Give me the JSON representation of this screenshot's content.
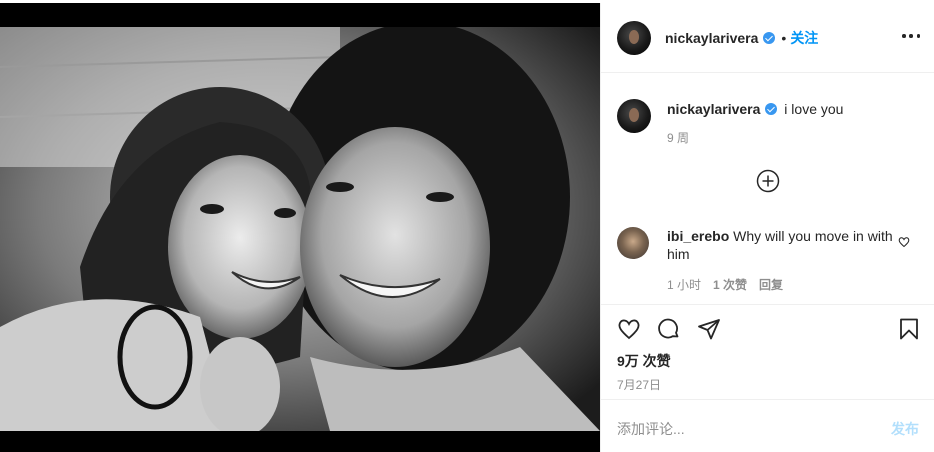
{
  "header": {
    "username": "nickaylarivera",
    "separator": "•",
    "follow_label": "关注"
  },
  "caption": {
    "username": "nickaylarivera",
    "text": "i love you",
    "time": "9 周"
  },
  "comment": {
    "username": "ibi_erebo",
    "text": "Why will you move in with him",
    "time": "1 小时",
    "likes": "1 次赞",
    "reply_label": "回复"
  },
  "post": {
    "likes": "9万 次赞",
    "date": "7月27日"
  },
  "add_comment": {
    "placeholder": "添加评论...",
    "post_label": "发布"
  },
  "icons": {
    "like": "heart-icon",
    "comment": "comment-icon",
    "share": "share-icon",
    "save": "bookmark-icon",
    "more": "more-options-icon",
    "load_more": "plus-circle-icon"
  },
  "colors": {
    "accent": "#0095f6",
    "verified": "#3897f0",
    "muted": "#8e8e8e",
    "post_disabled": "#b2dffc"
  }
}
